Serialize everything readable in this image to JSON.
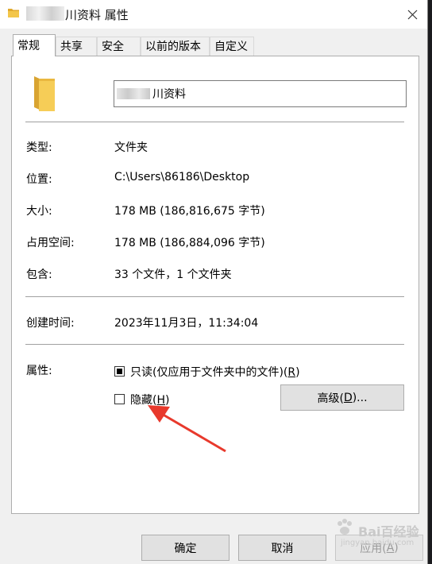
{
  "window": {
    "title_suffix": "川资料 属性",
    "close_glyph": "✕"
  },
  "tabs": [
    {
      "label": "常规",
      "active": true
    },
    {
      "label": "共享",
      "active": false
    },
    {
      "label": "安全",
      "active": false
    },
    {
      "label": "以前的版本",
      "active": false
    },
    {
      "label": "自定义",
      "active": false
    }
  ],
  "general": {
    "folder_name_visible": "川资料",
    "rows": [
      {
        "label": "类型:",
        "value": "文件夹"
      },
      {
        "label": "位置:",
        "value": "C:\\Users\\86186\\Desktop"
      },
      {
        "label": "大小:",
        "value": "178 MB (186,816,675 字节)"
      },
      {
        "label": "占用空间:",
        "value": "178 MB (186,884,096 字节)"
      },
      {
        "label": "包含:",
        "value": "33 个文件，1 个文件夹"
      }
    ],
    "created_label": "创建时间:",
    "created_value": "2023年11月3日，11:34:04",
    "attributes_label": "属性:",
    "readonly": {
      "text": "只读(仅应用于文件夹中的文件)(",
      "key": "R",
      "tail": ")"
    },
    "hidden": {
      "text": "隐藏(",
      "key": "H",
      "tail": ")"
    },
    "advanced": {
      "text": "高级(",
      "key": "D",
      "tail": ")..."
    }
  },
  "footer": {
    "ok": "确定",
    "cancel": "取消",
    "apply": {
      "text": "应用(",
      "key": "A",
      "tail": ")"
    }
  },
  "watermark": {
    "main": "Bai百经验",
    "sub": "jingyan.baidu.com"
  },
  "colors": {
    "folder": "#f3c64a",
    "folder_dark": "#e0a92c",
    "arrow": "#e8392c"
  }
}
